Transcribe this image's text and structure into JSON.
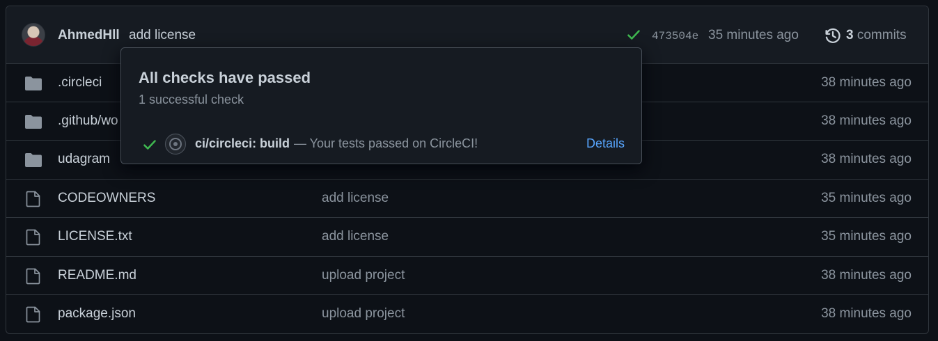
{
  "commit": {
    "author": "AhmedHll",
    "message": "add license",
    "sha": "473504e",
    "time": "35 minutes ago",
    "commits_count": "3",
    "commits_label": "commits"
  },
  "files": [
    {
      "name": ".circleci",
      "type": "folder",
      "message": "",
      "age": "38 minutes ago"
    },
    {
      "name": ".github/wo",
      "type": "folder",
      "message": "",
      "age": "38 minutes ago"
    },
    {
      "name": "udagram",
      "type": "folder",
      "message": "",
      "age": "38 minutes ago"
    },
    {
      "name": "CODEOWNERS",
      "type": "file",
      "message": "add license",
      "age": "35 minutes ago"
    },
    {
      "name": "LICENSE.txt",
      "type": "file",
      "message": "add license",
      "age": "35 minutes ago"
    },
    {
      "name": "README.md",
      "type": "file",
      "message": "upload project",
      "age": "38 minutes ago"
    },
    {
      "name": "package.json",
      "type": "file",
      "message": "upload project",
      "age": "38 minutes ago"
    }
  ],
  "checks_popover": {
    "title": "All checks have passed",
    "subtitle": "1 successful check",
    "check_name": "ci/circleci: build",
    "check_description": "— Your tests passed on CircleCI!",
    "details_label": "Details"
  },
  "colors": {
    "background": "#0d1117",
    "success": "#3fb950",
    "link": "#58a6ff",
    "folder": "#8b949e"
  }
}
